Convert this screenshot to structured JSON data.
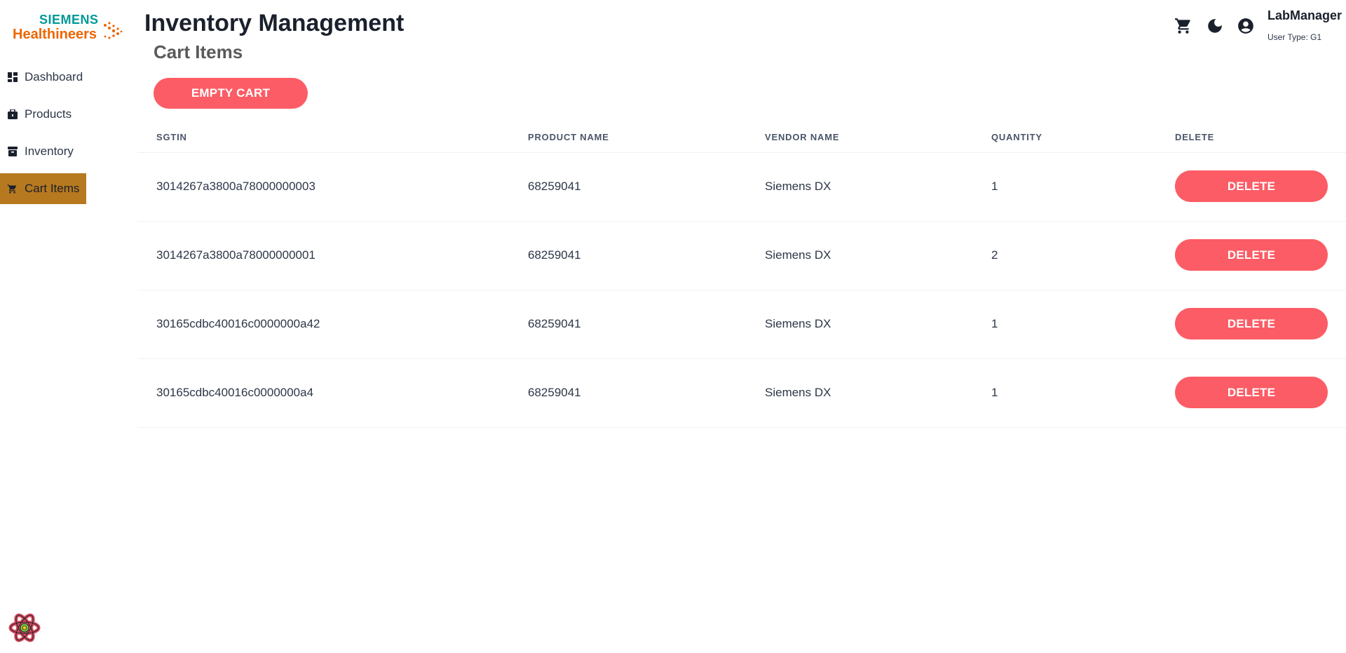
{
  "brand": {
    "top": "SIEMENS",
    "bottom": "Healthineers"
  },
  "app_title": "Inventory Management",
  "sidebar": {
    "items": [
      {
        "label": "Dashboard",
        "icon": "dashboard-icon",
        "active": false
      },
      {
        "label": "Products",
        "icon": "briefcase-icon",
        "active": false
      },
      {
        "label": "Inventory",
        "icon": "archive-icon",
        "active": false
      },
      {
        "label": "Cart Items",
        "icon": "cart-icon",
        "active": true
      }
    ]
  },
  "header": {
    "icons": [
      "cart-icon",
      "moon-icon",
      "account-circle-icon"
    ],
    "user_name": "LabManager",
    "user_type": "User Type: G1"
  },
  "page_title": "Cart Items",
  "empty_cart_label": "EMPTY CART",
  "table": {
    "columns": [
      "SGTIN",
      "PRODUCT NAME",
      "VENDOR NAME",
      "QUANTITY",
      "DELETE"
    ],
    "rows": [
      {
        "sgtin": "3014267a3800a78000000003",
        "product": "68259041",
        "vendor": "Siemens DX",
        "quantity": "1",
        "action": "DELETE"
      },
      {
        "sgtin": "3014267a3800a78000000001",
        "product": "68259041",
        "vendor": "Siemens DX",
        "quantity": "2",
        "action": "DELETE"
      },
      {
        "sgtin": "30165cdbc40016c0000000a42",
        "product": "68259041",
        "vendor": "Siemens DX",
        "quantity": "1",
        "action": "DELETE"
      },
      {
        "sgtin": "30165cdbc40016c0000000a4",
        "product": "68259041",
        "vendor": "Siemens DX",
        "quantity": "1",
        "action": "DELETE"
      }
    ]
  },
  "colors": {
    "accent": "#fc5c65",
    "active_nav": "#b7791f",
    "brand_teal": "#009999",
    "brand_orange": "#ec6602"
  }
}
